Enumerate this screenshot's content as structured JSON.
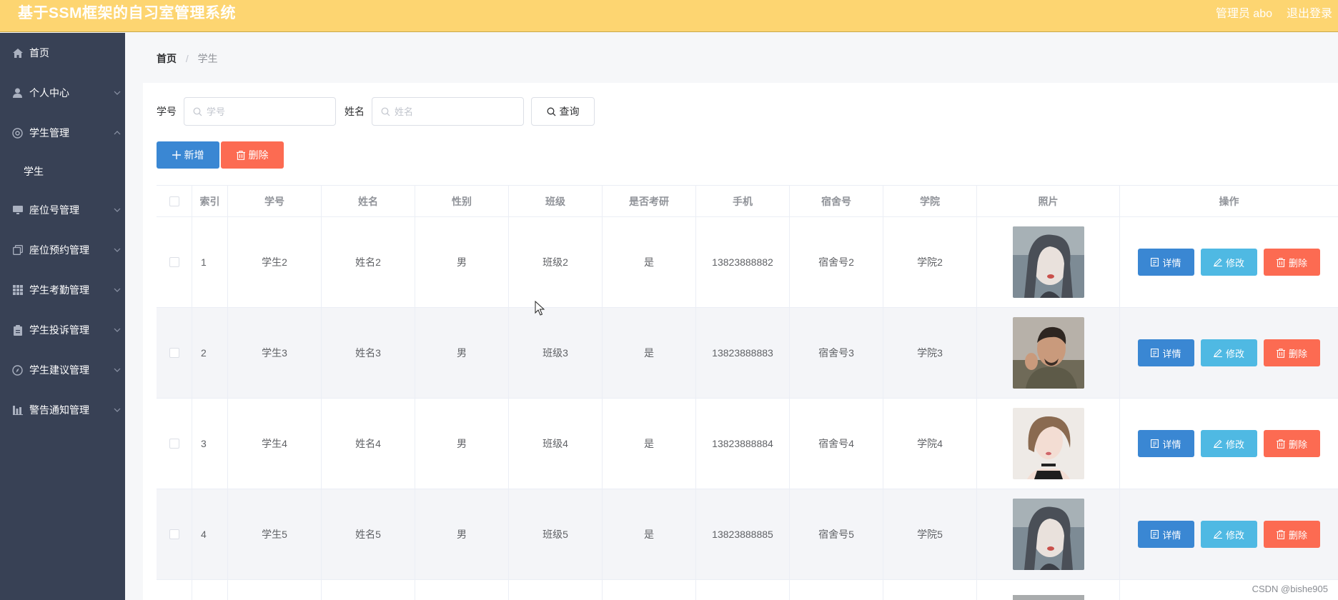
{
  "header": {
    "title": "基于SSM框架的自习室管理系统",
    "user": "管理员 abo",
    "logout": "退出登录"
  },
  "sidebar": {
    "items": [
      {
        "label": "首页",
        "icon": "home-icon"
      },
      {
        "label": "个人中心",
        "icon": "user-icon"
      },
      {
        "label": "学生管理",
        "icon": "group-icon",
        "expanded": true
      },
      {
        "label": "座位号管理",
        "icon": "monitor-icon"
      },
      {
        "label": "座位预约管理",
        "icon": "copy-icon"
      },
      {
        "label": "学生考勤管理",
        "icon": "grid-icon"
      },
      {
        "label": "学生投诉管理",
        "icon": "clipboard-icon"
      },
      {
        "label": "学生建议管理",
        "icon": "compass-icon"
      },
      {
        "label": "警告通知管理",
        "icon": "chart-icon"
      }
    ],
    "sub_item": "学生"
  },
  "breadcrumb": {
    "home": "首页",
    "separator": "/",
    "current": "学生"
  },
  "search": {
    "fields": [
      {
        "label": "学号",
        "placeholder": "学号"
      },
      {
        "label": "姓名",
        "placeholder": "姓名"
      }
    ],
    "query_label": "查询"
  },
  "actions": {
    "add_label": "新增",
    "delete_label": "删除"
  },
  "table": {
    "columns": [
      "索引",
      "学号",
      "姓名",
      "性别",
      "班级",
      "是否考研",
      "手机",
      "宿舍号",
      "学院",
      "照片",
      "操作"
    ],
    "rows": [
      {
        "index": "1",
        "student_no": "学生2",
        "name": "姓名2",
        "gender": "男",
        "class": "班级2",
        "kaoyan": "是",
        "phone": "13823888882",
        "dorm": "宿舍号2",
        "college": "学院2",
        "photo": "portrait-female-1"
      },
      {
        "index": "2",
        "student_no": "学生3",
        "name": "姓名3",
        "gender": "男",
        "class": "班级3",
        "kaoyan": "是",
        "phone": "13823888883",
        "dorm": "宿舍号3",
        "college": "学院3",
        "photo": "portrait-male-1"
      },
      {
        "index": "3",
        "student_no": "学生4",
        "name": "姓名4",
        "gender": "男",
        "class": "班级4",
        "kaoyan": "是",
        "phone": "13823888884",
        "dorm": "宿舍号4",
        "college": "学院4",
        "photo": "portrait-female-2"
      },
      {
        "index": "4",
        "student_no": "学生5",
        "name": "姓名5",
        "gender": "男",
        "class": "班级5",
        "kaoyan": "是",
        "phone": "13823888885",
        "dorm": "宿舍号5",
        "college": "学院5",
        "photo": "portrait-female-1"
      }
    ],
    "row_actions": {
      "detail": "详情",
      "edit": "修改",
      "delete": "删除"
    }
  },
  "watermark": "CSDN @bishe905",
  "colors": {
    "header": "#fdd571",
    "sidebar": "#384155",
    "primary": "#3a87d3",
    "info": "#4fb9e3",
    "danger": "#fc6b52"
  }
}
